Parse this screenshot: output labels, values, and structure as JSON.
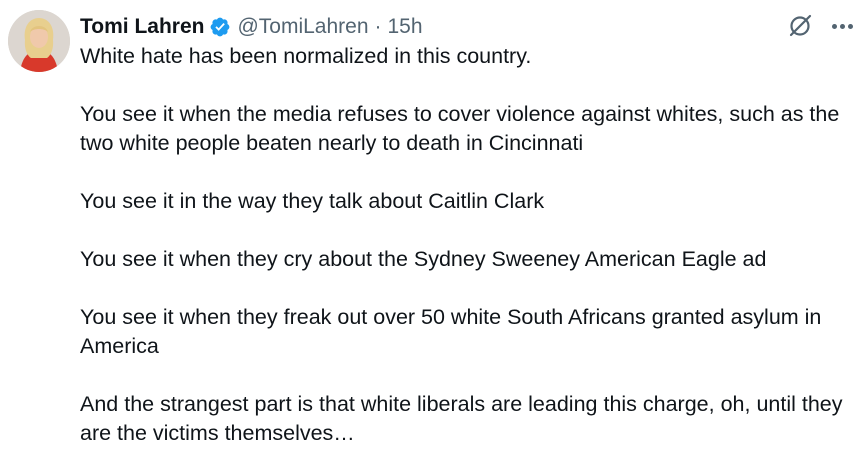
{
  "author": {
    "display_name": "Tomi Lahren",
    "handle": "@TomiLahren",
    "separator": "·",
    "time": "15h",
    "verified_color": "#1d9bf0"
  },
  "icons": {
    "verified": "verified-badge-icon",
    "grok": "grok-icon",
    "more": "more-options-icon"
  },
  "post": {
    "paragraphs": [
      "White hate has been normalized in this country.",
      "You see it when the media refuses to cover violence against whites, such as the two white people beaten nearly to death in Cincinnati",
      "You see it in the way they talk about Caitlin Clark",
      "You see it when they cry about the Sydney Sweeney American Eagle ad",
      "You see it when they freak out over 50 white South Africans granted asylum in America",
      "And the strangest part is that white liberals are leading this charge, oh, until they are the victims themselves…"
    ]
  }
}
